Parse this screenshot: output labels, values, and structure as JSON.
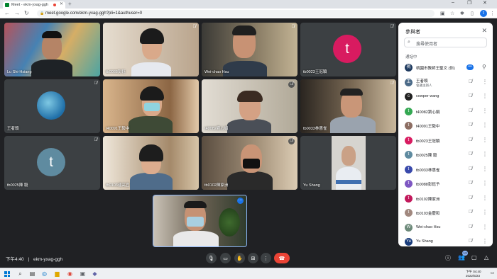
{
  "browser": {
    "tab_title": "Meet - ekm-yxag-ggh",
    "url": "meet.google.com/ekm-yxag-ggh?pli=1&authuser=0",
    "profile_initial": "t"
  },
  "tiles": [
    {
      "name": "Lu Shi-Hsiang"
    },
    {
      "name": "tb0088彭鈺"
    },
    {
      "name": "Wei-chao Hsu"
    },
    {
      "name": "tb0023王冠穎",
      "initial": "t",
      "color": "#d81b60"
    },
    {
      "name": "王者頭"
    },
    {
      "name": "t40091王毅中"
    },
    {
      "name": "t40082劉心娟"
    },
    {
      "name": "tb0033林惠雀"
    },
    {
      "name": "tb0025陳 毅",
      "initial": "t",
      "color": "#5f8ba0"
    },
    {
      "name": "tb0103連高宜"
    },
    {
      "name": "tb0102陳家洲"
    },
    {
      "name": "Yu Shang"
    }
  ],
  "meeting": {
    "time": "下午4:40",
    "separator": "|",
    "code": "ekm-yxag-ggh"
  },
  "controls": {
    "participant_count": "13"
  },
  "panel": {
    "title": "參與者",
    "search_placeholder": "搜尋使用者",
    "section": "通話中",
    "participants": [
      {
        "name": "桃園市教師王聖文 (你)",
        "initial": "桃",
        "color": "#1e3a5f"
      },
      {
        "name": "王者頭",
        "sub": "會議主辦人",
        "initial": "王",
        "color": "#4b6a88"
      },
      {
        "name": "cowper wang",
        "initial": "c",
        "color": "#222222"
      },
      {
        "name": "t40082劉心娟",
        "initial": "t",
        "color": "#33a852"
      },
      {
        "name": "t40091王毅中",
        "initial": "t",
        "color": "#8d6e63"
      },
      {
        "name": "tb0023王冠穎",
        "initial": "t",
        "color": "#d81b60"
      },
      {
        "name": "tb0025陳 毅",
        "initial": "t",
        "color": "#5f8ba0"
      },
      {
        "name": "tb0033林惠雀",
        "initial": "t",
        "color": "#3949ab"
      },
      {
        "name": "tb0088彭鈺予",
        "initial": "t",
        "color": "#7e57c2"
      },
      {
        "name": "tb0102陳家洲",
        "initial": "t",
        "color": "#c2185b"
      },
      {
        "name": "tb0103金慶和",
        "initial": "t",
        "color": "#a1887f"
      },
      {
        "name": "Wei-chao Hsu",
        "initial": "W",
        "color": "#6d8a7a"
      },
      {
        "name": "Yu Shang",
        "initial": "Yu",
        "color": "#1a3d7c"
      }
    ]
  },
  "taskbar": {
    "time": "下午 04:40",
    "date": "2022/5/23"
  }
}
